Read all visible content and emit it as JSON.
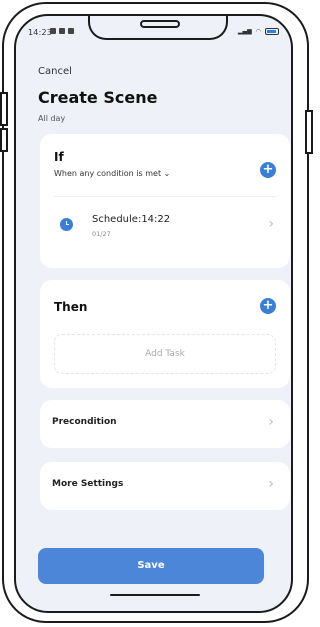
{
  "status": {
    "time": "14:23"
  },
  "header": {
    "cancel_label": "Cancel",
    "title": "Create Scene",
    "subtitle": "All day"
  },
  "if_card": {
    "title": "If",
    "condition_label": "When any condition is met ⌄",
    "schedule_title": "Schedule:14:22",
    "schedule_date": "01/27"
  },
  "then_card": {
    "title": "Then",
    "add_task_label": "Add Task"
  },
  "precondition": {
    "label": "Precondition"
  },
  "more_settings": {
    "label": "More Settings"
  },
  "save_label": "Save",
  "colors": {
    "accent": "#3a7fd6",
    "background": "#eef1f7"
  }
}
